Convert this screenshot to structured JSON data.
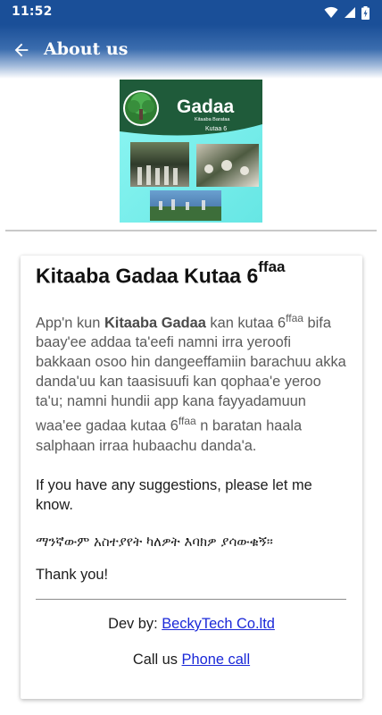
{
  "status_bar": {
    "time": "11:52"
  },
  "app_bar": {
    "title": "About us"
  },
  "logo": {
    "title": "Gadaa",
    "subtitle1": "Kitaaba Barataa",
    "subtitle2": "Kutaa 6"
  },
  "card": {
    "title": "Kitaaba Gadaa Kutaa 6",
    "title_sup": "ffaa",
    "desc": {
      "part1": "App'n kun ",
      "bold": "Kitaaba Gadaa",
      "part2": " kan kutaa 6",
      "sup1": "ffaa",
      "part3": " bifa baay'ee addaa ta'eefi namni irra yeroofi bakkaan osoo hin dangeeffamiin barachuu akka danda'uu kan taasisuufi kan qophaa'e yeroo ta'u; namni hundii app kana fayyadamuun waa'ee gadaa kutaa 6",
      "sup2": "ffaa",
      "part4": " n baratan haala salphaan irraa hubaachu danda'a."
    },
    "suggestions": "If you have any suggestions, please let me know.",
    "amharic": "ማንኛውም አስተያየት ካለዎት እባክዎ ያሳውቁኝ።",
    "thanks": "Thank you!",
    "dev_label": "Dev by: ",
    "dev_link": "BeckyTech Co.ltd",
    "call_label": "Call us ",
    "call_link": "Phone call"
  },
  "colors": {
    "status_bar": "#1a4f98",
    "link": "#1a28d8",
    "logo_bg": "#7ff0ee"
  }
}
